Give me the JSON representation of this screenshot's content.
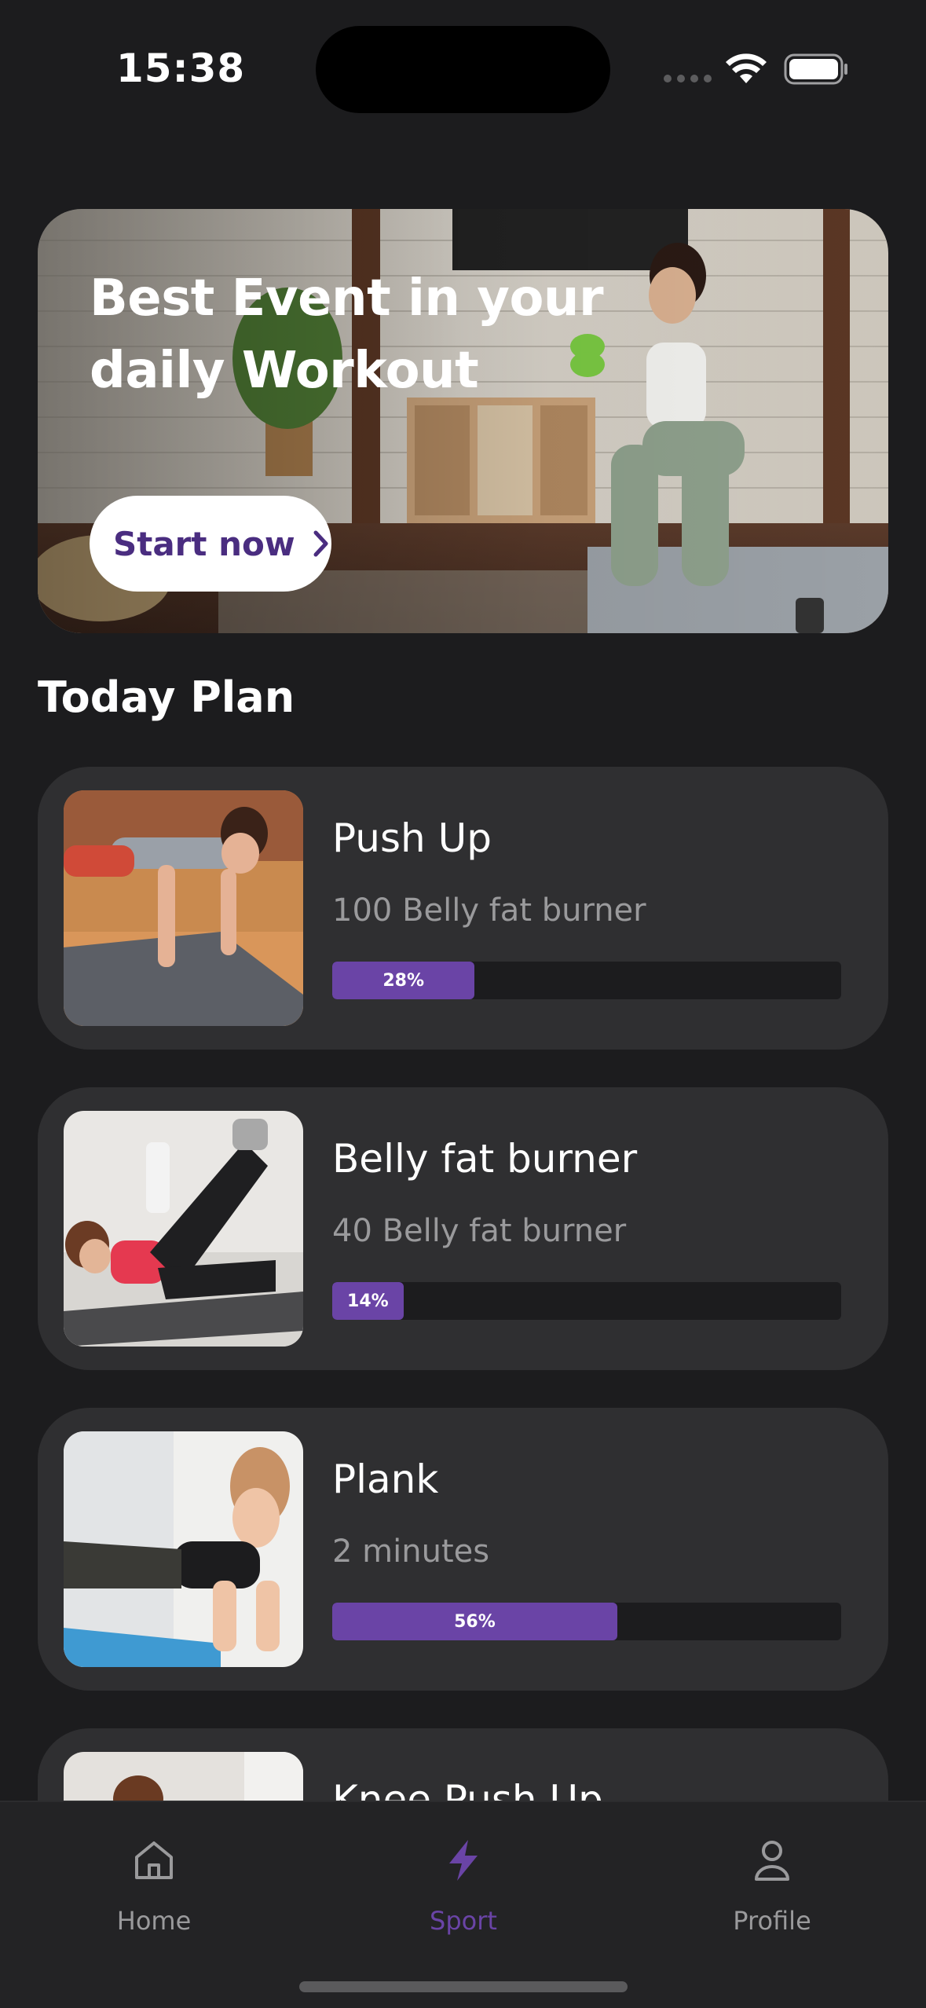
{
  "status_bar": {
    "time": "15:38"
  },
  "hero": {
    "title_line1": "Best Event in your",
    "title_line2": "daily Workout",
    "cta_label": "Start now",
    "cta_icon": "chevron-right-icon",
    "image": "woman squatting with green dumbbells in living room"
  },
  "section_title": "Today Plan",
  "plans": [
    {
      "name": "Push Up",
      "subtitle": "100 Belly fat burner",
      "progress": 28,
      "progress_label": "28%",
      "image": "woman doing push up on mat"
    },
    {
      "name": "Belly fat burner",
      "subtitle": "40 Belly fat burner",
      "progress": 14,
      "progress_label": "14%",
      "image": "woman doing bicycle crunch on mat"
    },
    {
      "name": "Plank",
      "subtitle": "2 minutes",
      "progress": 56,
      "progress_label": "56%",
      "image": "woman holding forearm plank"
    },
    {
      "name": "Knee Push Up",
      "image": "woman on mat (partially visible)"
    }
  ],
  "tabbar": {
    "items": [
      {
        "label": "Home",
        "icon": "home-icon",
        "active": false
      },
      {
        "label": "Sport",
        "icon": "lightning-bolt-icon",
        "active": true
      },
      {
        "label": "Profile",
        "icon": "person-icon",
        "active": false
      }
    ]
  },
  "colors": {
    "background": "#1c1c1e",
    "card": "#2f2f31",
    "accent": "#6a44a6",
    "cta_text": "#4a2d80",
    "muted_text": "#9a9a9c"
  }
}
